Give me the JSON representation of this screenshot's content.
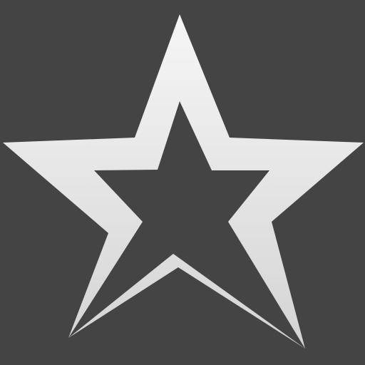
{
  "background_color": "#444444",
  "icon": {
    "name": "star-outline-icon",
    "gradient_top_color": "#f6f6f6",
    "gradient_bottom_color": "#d4d4d4"
  }
}
